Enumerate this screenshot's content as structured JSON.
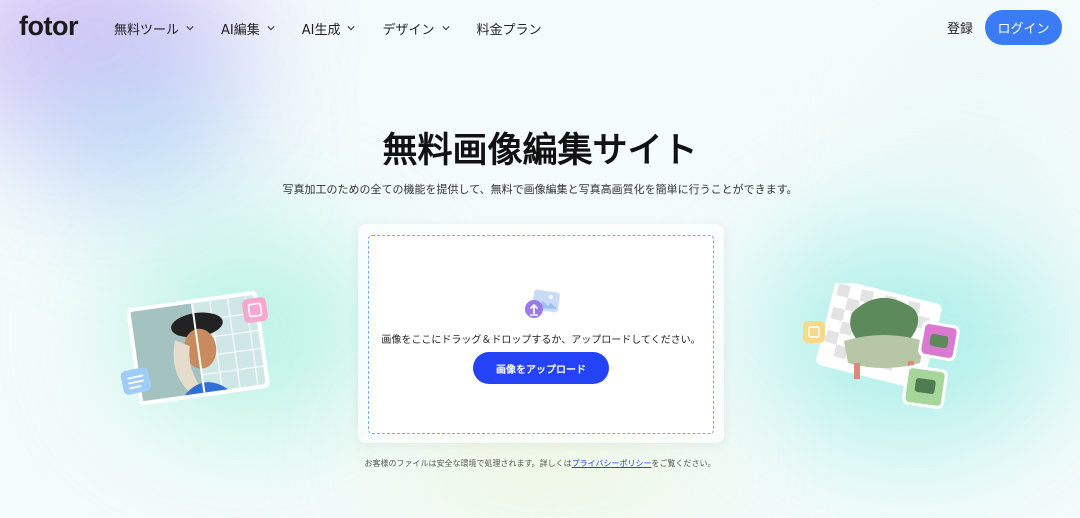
{
  "header": {
    "logo": "fotor",
    "nav": [
      {
        "label": "無料ツール",
        "has_dropdown": true
      },
      {
        "label": "AI編集",
        "has_dropdown": true
      },
      {
        "label": "AI生成",
        "has_dropdown": true
      },
      {
        "label": "デザイン",
        "has_dropdown": true
      },
      {
        "label": "料金プラン",
        "has_dropdown": false
      }
    ],
    "signup_label": "登録",
    "login_label": "ログイン"
  },
  "hero": {
    "title": "無料画像編集サイト",
    "subtitle": "写真加工のための全ての機能を提供して、無料で画像編集と写真高画質化を簡単に行うことができます。"
  },
  "upload": {
    "drop_text": "画像をここにドラッグ＆ドロップするか、アップロードしてください。",
    "button_label": "画像をアップロード",
    "icon": "image-upload-icon"
  },
  "privacy": {
    "prefix": "お客様のファイルは安全な環境で処理されます。詳しくは",
    "link": "プライバシーポリシー",
    "suffix": "をご覧ください。"
  },
  "colors": {
    "accent": "#3b7bf6",
    "upload_button": "#2443f6",
    "dropzone_border": "#7aa9f5"
  }
}
